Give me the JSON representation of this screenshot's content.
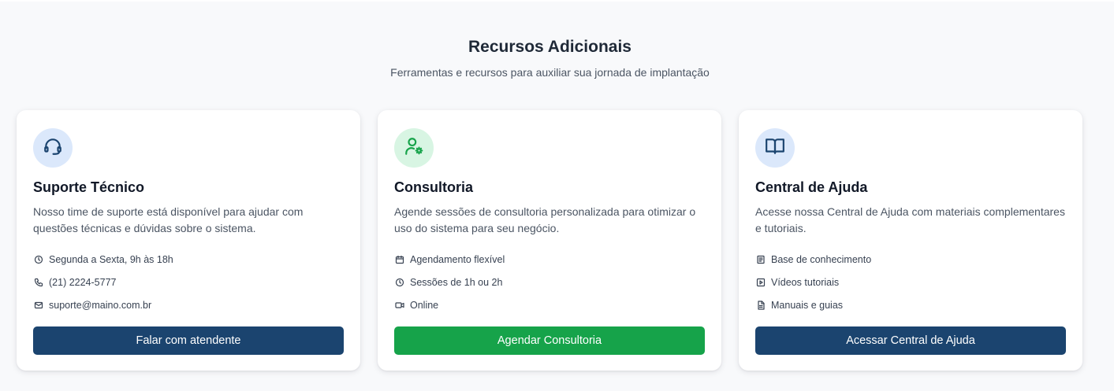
{
  "section": {
    "title": "Recursos Adicionais",
    "subtitle": "Ferramentas e recursos para auxiliar sua jornada de implantação"
  },
  "colors": {
    "navy": "#1b446f",
    "green": "#16a34a",
    "icon_bg_blue": "#dbe8fb",
    "icon_bg_green": "#d8f5e3"
  },
  "cards": [
    {
      "icon": "headset-icon",
      "title": "Suporte Técnico",
      "description": "Nosso time de suporte está disponível para ajudar com questões técnicas e dúvidas sobre o sistema.",
      "features": [
        {
          "icon": "clock-icon",
          "label": "Segunda a Sexta, 9h às 18h"
        },
        {
          "icon": "phone-icon",
          "label": "(21) 2224-5777"
        },
        {
          "icon": "mail-icon",
          "label": "suporte@maino.com.br"
        }
      ],
      "button": "Falar com atendente"
    },
    {
      "icon": "user-gear-icon",
      "title": "Consultoria",
      "description": "Agende sessões de consultoria personalizada para otimizar o uso do sistema para seu negócio.",
      "features": [
        {
          "icon": "calendar-icon",
          "label": "Agendamento flexível"
        },
        {
          "icon": "clock-icon",
          "label": "Sessões de 1h ou 2h"
        },
        {
          "icon": "video-icon",
          "label": "Online"
        }
      ],
      "button": "Agendar Consultoria"
    },
    {
      "icon": "book-open-icon",
      "title": "Central de Ajuda",
      "description": "Acesse nossa Central de Ajuda com materiais complementares e tutoriais.",
      "features": [
        {
          "icon": "knowledge-base-icon",
          "label": "Base de conhecimento"
        },
        {
          "icon": "play-icon",
          "label": "Vídeos tutoriais"
        },
        {
          "icon": "document-icon",
          "label": "Manuais e guias"
        }
      ],
      "button": "Acessar Central de Ajuda"
    }
  ]
}
